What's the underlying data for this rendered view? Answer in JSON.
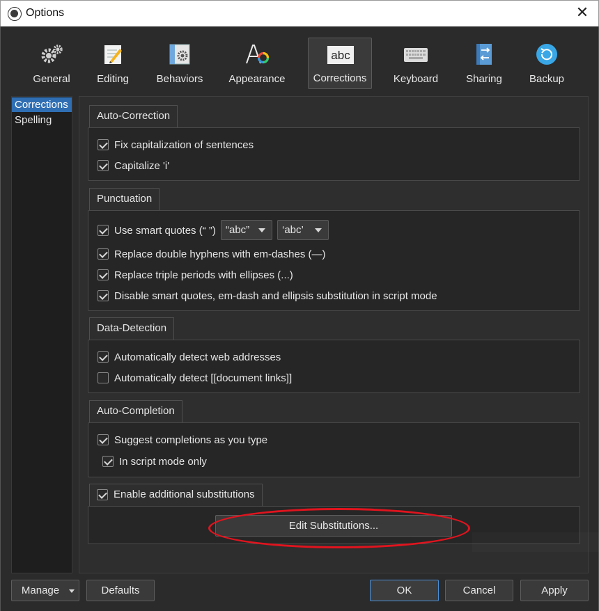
{
  "window": {
    "title": "Options"
  },
  "toolbar": {
    "tabs": [
      {
        "label": "General",
        "icon": "gears-icon"
      },
      {
        "label": "Editing",
        "icon": "pencil-note-icon"
      },
      {
        "label": "Behaviors",
        "icon": "gear-window-icon"
      },
      {
        "label": "Appearance",
        "icon": "font-color-icon"
      },
      {
        "label": "Corrections",
        "icon": "abc-icon",
        "active": true
      },
      {
        "label": "Keyboard",
        "icon": "keyboard-icon"
      },
      {
        "label": "Sharing",
        "icon": "sharing-arrows-icon"
      },
      {
        "label": "Backup",
        "icon": "backup-icon"
      }
    ]
  },
  "sidebar": {
    "items": [
      {
        "label": "Corrections",
        "selected": true
      },
      {
        "label": "Spelling",
        "selected": false
      }
    ]
  },
  "auto_correction": {
    "title": "Auto-Correction",
    "fix_cap": {
      "label": "Fix capitalization of sentences",
      "checked": true
    },
    "cap_i": {
      "label": "Capitalize 'i'",
      "checked": true
    }
  },
  "punctuation": {
    "title": "Punctuation",
    "smart_quotes": {
      "label": "Use smart quotes (“ ”)",
      "checked": true
    },
    "double_quote_style": "“abc”",
    "single_quote_style": "‘abc’",
    "em_dash": {
      "label": "Replace double hyphens with em-dashes (—)",
      "checked": true
    },
    "ellipses": {
      "label": "Replace triple periods with ellipses (...)",
      "checked": true
    },
    "disable_script": {
      "label": "Disable smart quotes, em-dash and ellipsis substitution in script mode",
      "checked": true
    }
  },
  "data_detection": {
    "title": "Data-Detection",
    "web": {
      "label": "Automatically detect web addresses",
      "checked": true
    },
    "doc_links": {
      "label": "Automatically detect [[document links]]",
      "checked": false
    }
  },
  "auto_completion": {
    "title": "Auto-Completion",
    "suggest": {
      "label": "Suggest completions as you type",
      "checked": true
    },
    "script_only": {
      "label": "In script mode only",
      "checked": true
    }
  },
  "substitutions": {
    "enable": {
      "label": "Enable additional substitutions",
      "checked": true
    },
    "edit_button": "Edit Substitutions..."
  },
  "footer": {
    "manage": "Manage",
    "defaults": "Defaults",
    "ok": "OK",
    "cancel": "Cancel",
    "apply": "Apply"
  },
  "colors": {
    "accent": "#2f6eb3",
    "annotation": "#e0141e"
  }
}
